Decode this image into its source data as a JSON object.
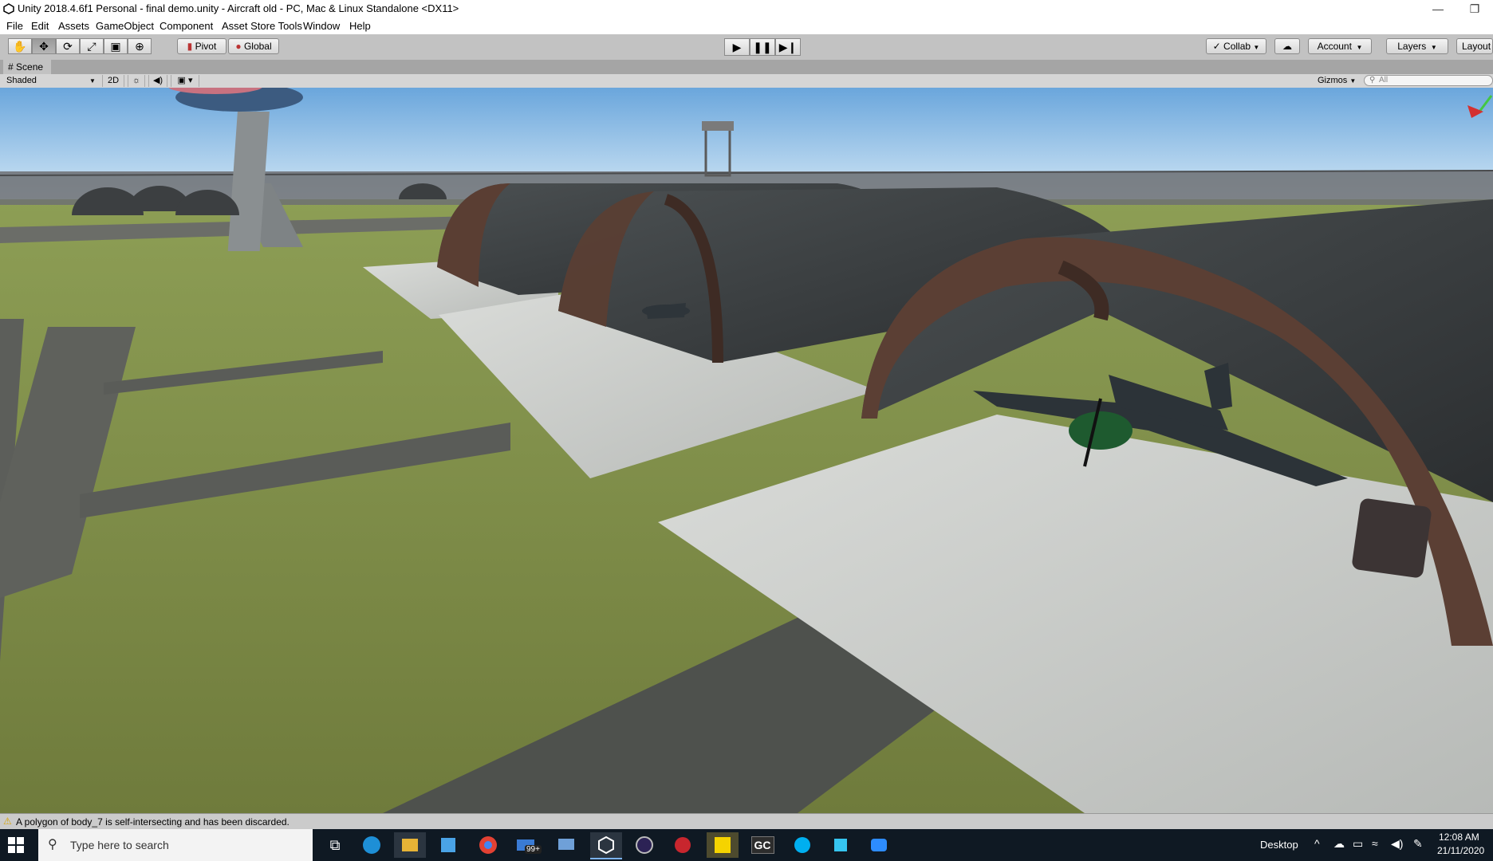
{
  "window": {
    "title": "Unity 2018.4.6f1 Personal - final demo.unity - Aircraft old - PC, Mac & Linux Standalone <DX11>",
    "minimize": "—",
    "maximize": "❐"
  },
  "menu": [
    "File",
    "Edit",
    "Assets",
    "GameObject",
    "Component",
    "Asset Store Tools",
    "Window",
    "Help"
  ],
  "toolbar": {
    "tools": [
      "hand-tool",
      "move-tool",
      "rotate-tool",
      "scale-tool",
      "rect-tool",
      "transform-tool"
    ],
    "pivot": "Pivot",
    "global": "Global",
    "collab": "Collab",
    "account": "Account",
    "layers": "Layers",
    "layout": "Layout"
  },
  "scene": {
    "tab": "Scene",
    "shading": "Shaded",
    "mode_2d": "2D",
    "gizmos": "Gizmos",
    "search_placeholder": "All"
  },
  "status": {
    "message": "A polygon of body_7 is self-intersecting and has been discarded."
  },
  "taskbar": {
    "search_placeholder": "Type here to search",
    "mail_badge": "99+",
    "desktop_label": "Desktop",
    "time": "12:08 AM",
    "date": "21/11/2020"
  },
  "colors": {
    "sky_top": "#7fb3e0",
    "sky_horizon": "#d7e9f7",
    "grass": "#7b8a3e",
    "hangar": "#3a3d3f",
    "hangar_rim": "#5a3e33",
    "concrete": "#c9cdcc",
    "taskbar": "#0f1923"
  }
}
